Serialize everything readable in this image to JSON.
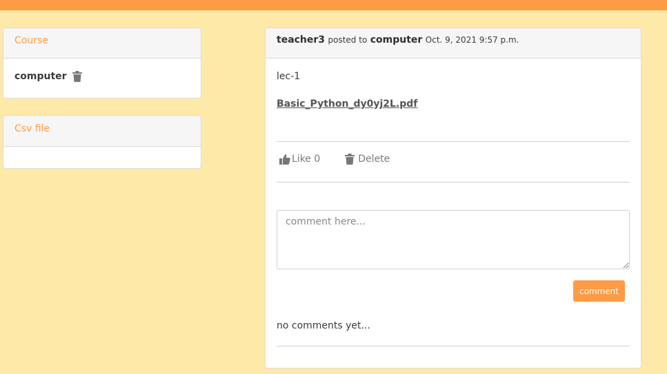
{
  "course_card": {
    "title": "Course",
    "course_name": "computer"
  },
  "csv_card": {
    "title": "Csv file"
  },
  "post": {
    "author": "teacher3",
    "posted_to_text": "posted to",
    "course": "computer",
    "timestamp": "Oct. 9, 2021 9:57 p.m.",
    "lecture_title": "lec-1",
    "attachment": "Basic_Python_dy0yj2L.pdf",
    "like_label": "Like 0",
    "delete_label": "Delete",
    "comment_placeholder": "comment here...",
    "comment_button": "comment",
    "no_comments": "no comments yet..."
  },
  "colors": {
    "accent": "#ff9a45",
    "background": "#ffe9a8"
  },
  "icons": [
    "trash-icon",
    "thumbs-up-icon"
  ]
}
